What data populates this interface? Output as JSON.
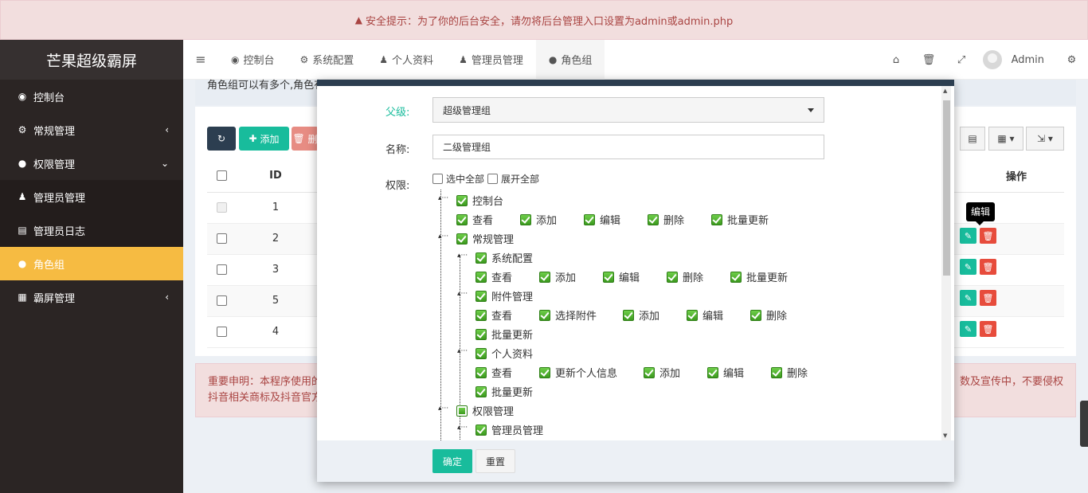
{
  "warning": {
    "icon": "warning-icon",
    "text": "安全提示：为了你的后台安全，请勿将后台管理入口设置为admin或admin.php"
  },
  "sidebar": {
    "logo": "芒果超级霸屏",
    "items": [
      {
        "icon": "dashboard-icon",
        "label": "控制台",
        "arrow": ""
      },
      {
        "icon": "cogs-icon",
        "label": "常规管理",
        "arrow": "‹"
      },
      {
        "icon": "users-icon",
        "label": "权限管理",
        "arrow": "⌄"
      },
      {
        "icon": "user-icon",
        "label": "管理员管理",
        "arrow": ""
      },
      {
        "icon": "list-icon",
        "label": "管理员日志",
        "arrow": ""
      },
      {
        "icon": "group-icon",
        "label": "角色组",
        "arrow": ""
      },
      {
        "icon": "grid-icon",
        "label": "霸屏管理",
        "arrow": "‹"
      }
    ]
  },
  "topbar": {
    "tabs": [
      {
        "icon": "dashboard-icon",
        "label": "控制台"
      },
      {
        "icon": "gear-icon",
        "label": "系统配置"
      },
      {
        "icon": "user-icon",
        "label": "个人资料"
      },
      {
        "icon": "user-icon",
        "label": "管理员管理"
      },
      {
        "icon": "users-icon",
        "label": "角色组"
      }
    ],
    "user": "Admin"
  },
  "content": {
    "description": "角色组可以有多个,角色有",
    "buttons": {
      "add": "添加",
      "delete": "删"
    },
    "table": {
      "headers": {
        "id": "ID",
        "ops": "操作"
      },
      "rows": [
        {
          "id": "1",
          "disabled": true
        },
        {
          "id": "2",
          "disabled": false
        },
        {
          "id": "3",
          "disabled": false
        },
        {
          "id": "5",
          "disabled": false
        },
        {
          "id": "4",
          "disabled": false
        }
      ]
    },
    "tooltip": "编辑",
    "notice_line1_left": "重要申明：本程序使用的",
    "notice_line1_right": "数及宣传中，不要侵权",
    "notice_line2": "抖音相关商标及抖音官方"
  },
  "modal": {
    "parent_label": "父级:",
    "parent_value": "超级管理组",
    "name_label": "名称:",
    "name_value": "二级管理组",
    "perm_label": "权限:",
    "select_all": "选中全部",
    "expand_all": "展开全部",
    "tree": {
      "dashboard": "控制台",
      "dashboard_actions": [
        "查看",
        "添加",
        "编辑",
        "删除",
        "批量更新"
      ],
      "general": "常规管理",
      "sysconfig": "系统配置",
      "sysconfig_actions": [
        "查看",
        "添加",
        "编辑",
        "删除",
        "批量更新"
      ],
      "attachment": "附件管理",
      "attachment_actions": [
        "查看",
        "选择附件",
        "添加",
        "编辑",
        "删除",
        "批量更新"
      ],
      "profile": "个人资料",
      "profile_actions": [
        "查看",
        "更新个人信息",
        "添加",
        "编辑",
        "删除",
        "批量更新"
      ],
      "auth": "权限管理",
      "admin_mgmt": "管理员管理"
    },
    "confirm": "确定",
    "reset": "重置"
  }
}
